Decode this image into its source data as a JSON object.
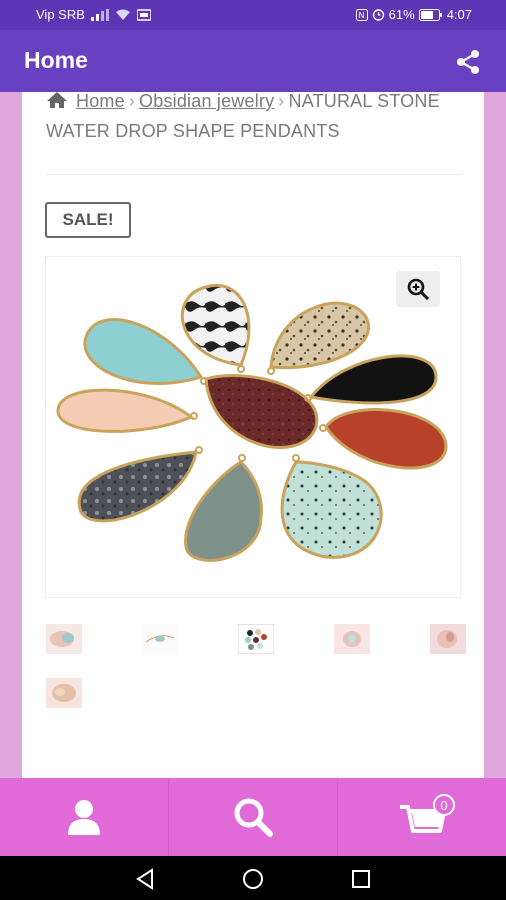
{
  "status_bar": {
    "carrier": "Vip SRB",
    "battery": "61%",
    "time": "4:07"
  },
  "app_bar": {
    "title": "Home",
    "share_icon": "share-icon"
  },
  "breadcrumb": {
    "home": "Home",
    "separator": "›",
    "category": "Obsidian jewelry",
    "current": "NATURAL STONE WATER DROP SHAPE PENDANTS"
  },
  "product": {
    "sale_badge": "SALE!",
    "zoom_icon": "zoom-in-icon",
    "thumbnail_count": 6
  },
  "bottom_nav": {
    "items": [
      {
        "icon": "user-icon"
      },
      {
        "icon": "search-icon"
      },
      {
        "icon": "cart-icon",
        "badge": "0"
      }
    ]
  },
  "colors": {
    "status_bar": "#5d36b5",
    "app_bar": "#6841c2",
    "bottom_nav": "#e06ad8",
    "page_background": "#dfa7dc"
  }
}
